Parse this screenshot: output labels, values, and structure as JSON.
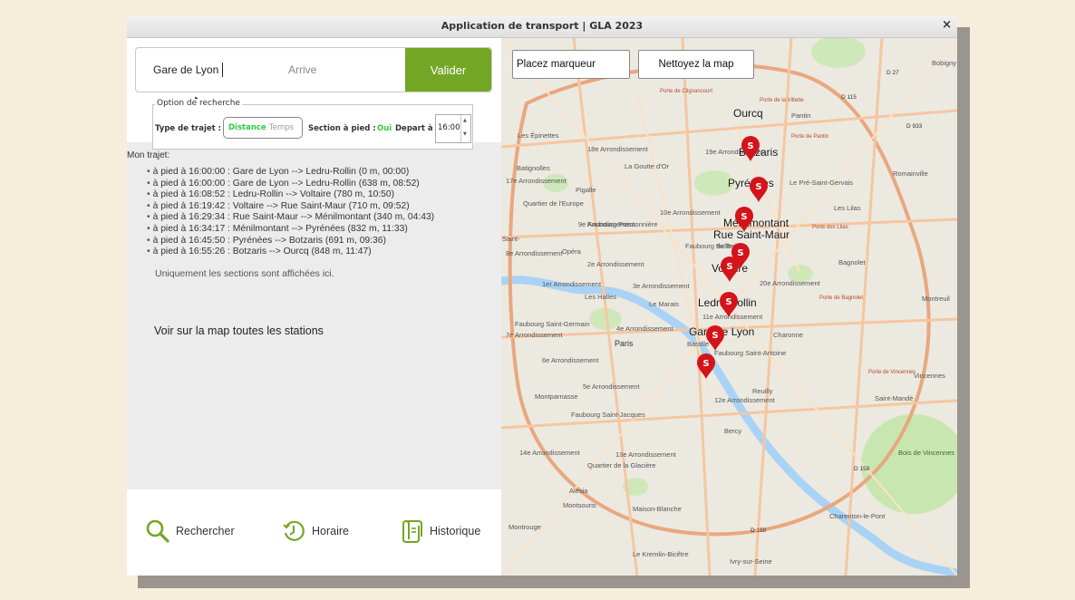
{
  "window": {
    "title": "Application de transport | GLA 2023",
    "close_glyph": "×"
  },
  "search": {
    "depart_value": "Gare de Lyon",
    "arrive_placeholder": "Arrive",
    "submit_label": "Valider"
  },
  "options": {
    "legend": "Option de recherche",
    "trajet_label": "Type de trajet :",
    "trajet_options": [
      "Distance",
      "Temps"
    ],
    "trajet_selected": "Distance",
    "pied_label": "Section à pied :",
    "pied_value": "Oui",
    "depart_label": "Depart à :",
    "depart_time": "16:00"
  },
  "trajet": {
    "title": "Mon trajet:",
    "steps": [
      "à pied à 16:00:00 : Gare de Lyon --> Ledru-Rollin (0 m, 00:00)",
      "à pied à 16:00:00 : Gare de Lyon --> Ledru-Rollin (638 m, 08:52)",
      "à pied à 16:08:52 : Ledru-Rollin --> Voltaire (780 m, 10:50)",
      "à pied à 16:19:42 : Voltaire --> Rue Saint-Maur (710 m, 09:52)",
      "à pied à 16:29:34 : Rue Saint-Maur --> Ménilmontant (340 m, 04:43)",
      "à pied à 16:34:17 : Ménilmontant --> Pyrénées (832 m, 11:33)",
      "à pied à 16:45:50 : Pyrénées --> Botzaris (691 m, 09:36)",
      "à pied à 16:55:26 : Botzaris --> Ourcq (848 m, 11:47)"
    ],
    "note": "Uniquement les sections sont affichées ici.",
    "all_stations_link": "Voir sur la map toutes les stations"
  },
  "nav": {
    "search_label": "Rechercher",
    "horaire_label": "Horaire",
    "history_label": "Historique"
  },
  "map": {
    "place_marker_label": "Placez marqueur",
    "clear_map_label": "Nettoyez la map",
    "marker_glyph": "S",
    "station_labels": [
      "Ourcq",
      "Botzaris",
      "Pyrénées",
      "Ménilmontant",
      "Rue Saint-Maur",
      "Voltaire",
      "Ledru-Rollin",
      "Gare de Lyon"
    ],
    "district_labels": [
      "19e Arrondissement",
      "18e Arrondissement",
      "17e Arrondissement",
      "20e Arrondissement",
      "11e Arrondissement",
      "10e Arrondissement",
      "9e Arrondissement",
      "8e Arrondissement",
      "3e Arrondissement",
      "2e Arrondissement",
      "1er Arrondissement",
      "4e Arrondissement",
      "12e Arrondissement",
      "5e Arrondissement",
      "6e Arrondissement",
      "13e Arrondissement",
      "14e Arrondissement",
      "7e Arrondissement",
      "Les Épinettes",
      "Batignolles",
      "Pigalle",
      "La Goutte d'Or",
      "Quartier de l'Europe",
      "Faubourg Poissonnière",
      "Opéra",
      "Les Halles",
      "Le Marais",
      "Paris",
      "Faubourg Saint-Germain",
      "Faubourg du Temple",
      "Belleville",
      "Charonne",
      "Bastille",
      "Faubourg Saint-Antoine",
      "Reuilly",
      "Bercy",
      "Montparnasse",
      "Faubourg Saint-Jacques",
      "Quartier de la Glacière",
      "Maison-Blanche",
      "Alésia",
      "Montsouris",
      "Montrouge",
      "Le Kremlin-Bicêtre",
      "Ivry-sur-Seine",
      "Charenton-le-Pont",
      "Saint-Mandé",
      "Vincennes",
      "Bois de Vincennes",
      "Montreuil",
      "Bagnolet",
      "Les Lilas",
      "Romainville",
      "Pantin",
      "Le Pré-Saint-Gervais",
      "Bobigny",
      "Saint-",
      "Porte de la Villette",
      "Porte de Pantin",
      "Porte des Lilas",
      "Porte de Bagnolet",
      "Porte de Vincennes",
      "Porte de Clignancourt",
      "D 27",
      "D 115",
      "D 933",
      "D 158",
      "D 150"
    ],
    "colors": {
      "marker": "#d3141a",
      "park": "#c8e6b0",
      "water": "#a9d3f5",
      "road": "#f5c7a0",
      "periph": "#e9a77e"
    }
  },
  "colors": {
    "accent": "#74a626",
    "background": "#f7eddb",
    "active_option": "#2ecc40"
  }
}
